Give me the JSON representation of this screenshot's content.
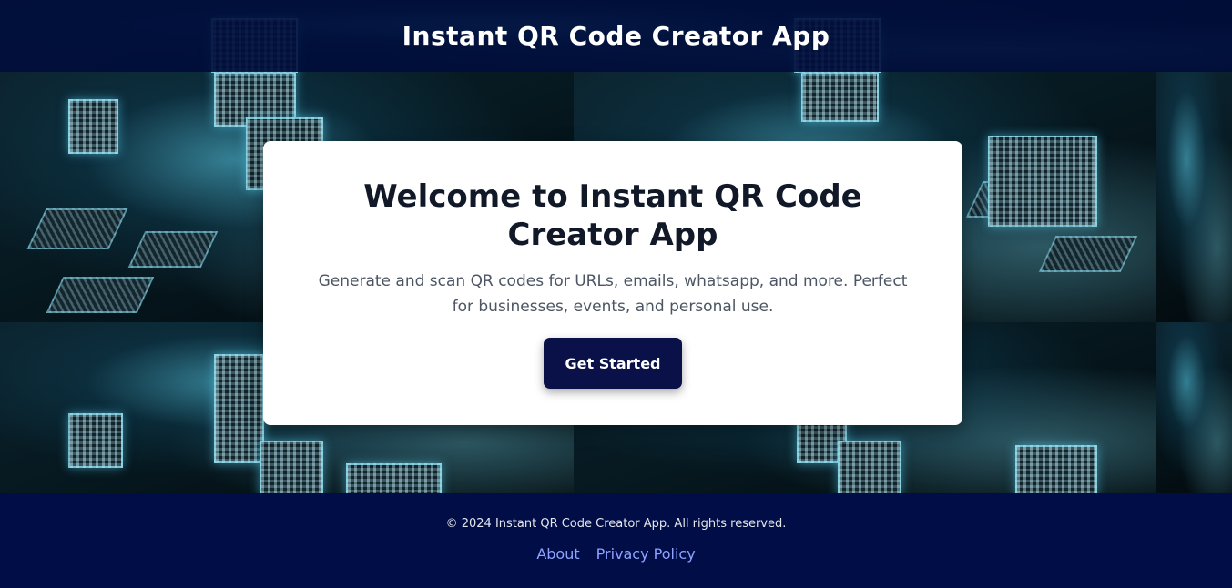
{
  "header": {
    "title": "Instant QR Code Creator App"
  },
  "hero": {
    "title": "Welcome to Instant QR Code Creator App",
    "description": "Generate and scan QR codes for URLs, emails, whatsapp, and more. Perfect for businesses, events, and personal use.",
    "cta_label": "Get Started"
  },
  "footer": {
    "copyright": "© 2024 Instant QR Code Creator App. All rights reserved.",
    "links": [
      {
        "label": "About"
      },
      {
        "label": "Privacy Policy"
      }
    ]
  },
  "colors": {
    "header_bg": "#000d3a",
    "button_bg": "#0a1148",
    "footer_bg": "#000d47",
    "link": "#8ea2ff"
  }
}
